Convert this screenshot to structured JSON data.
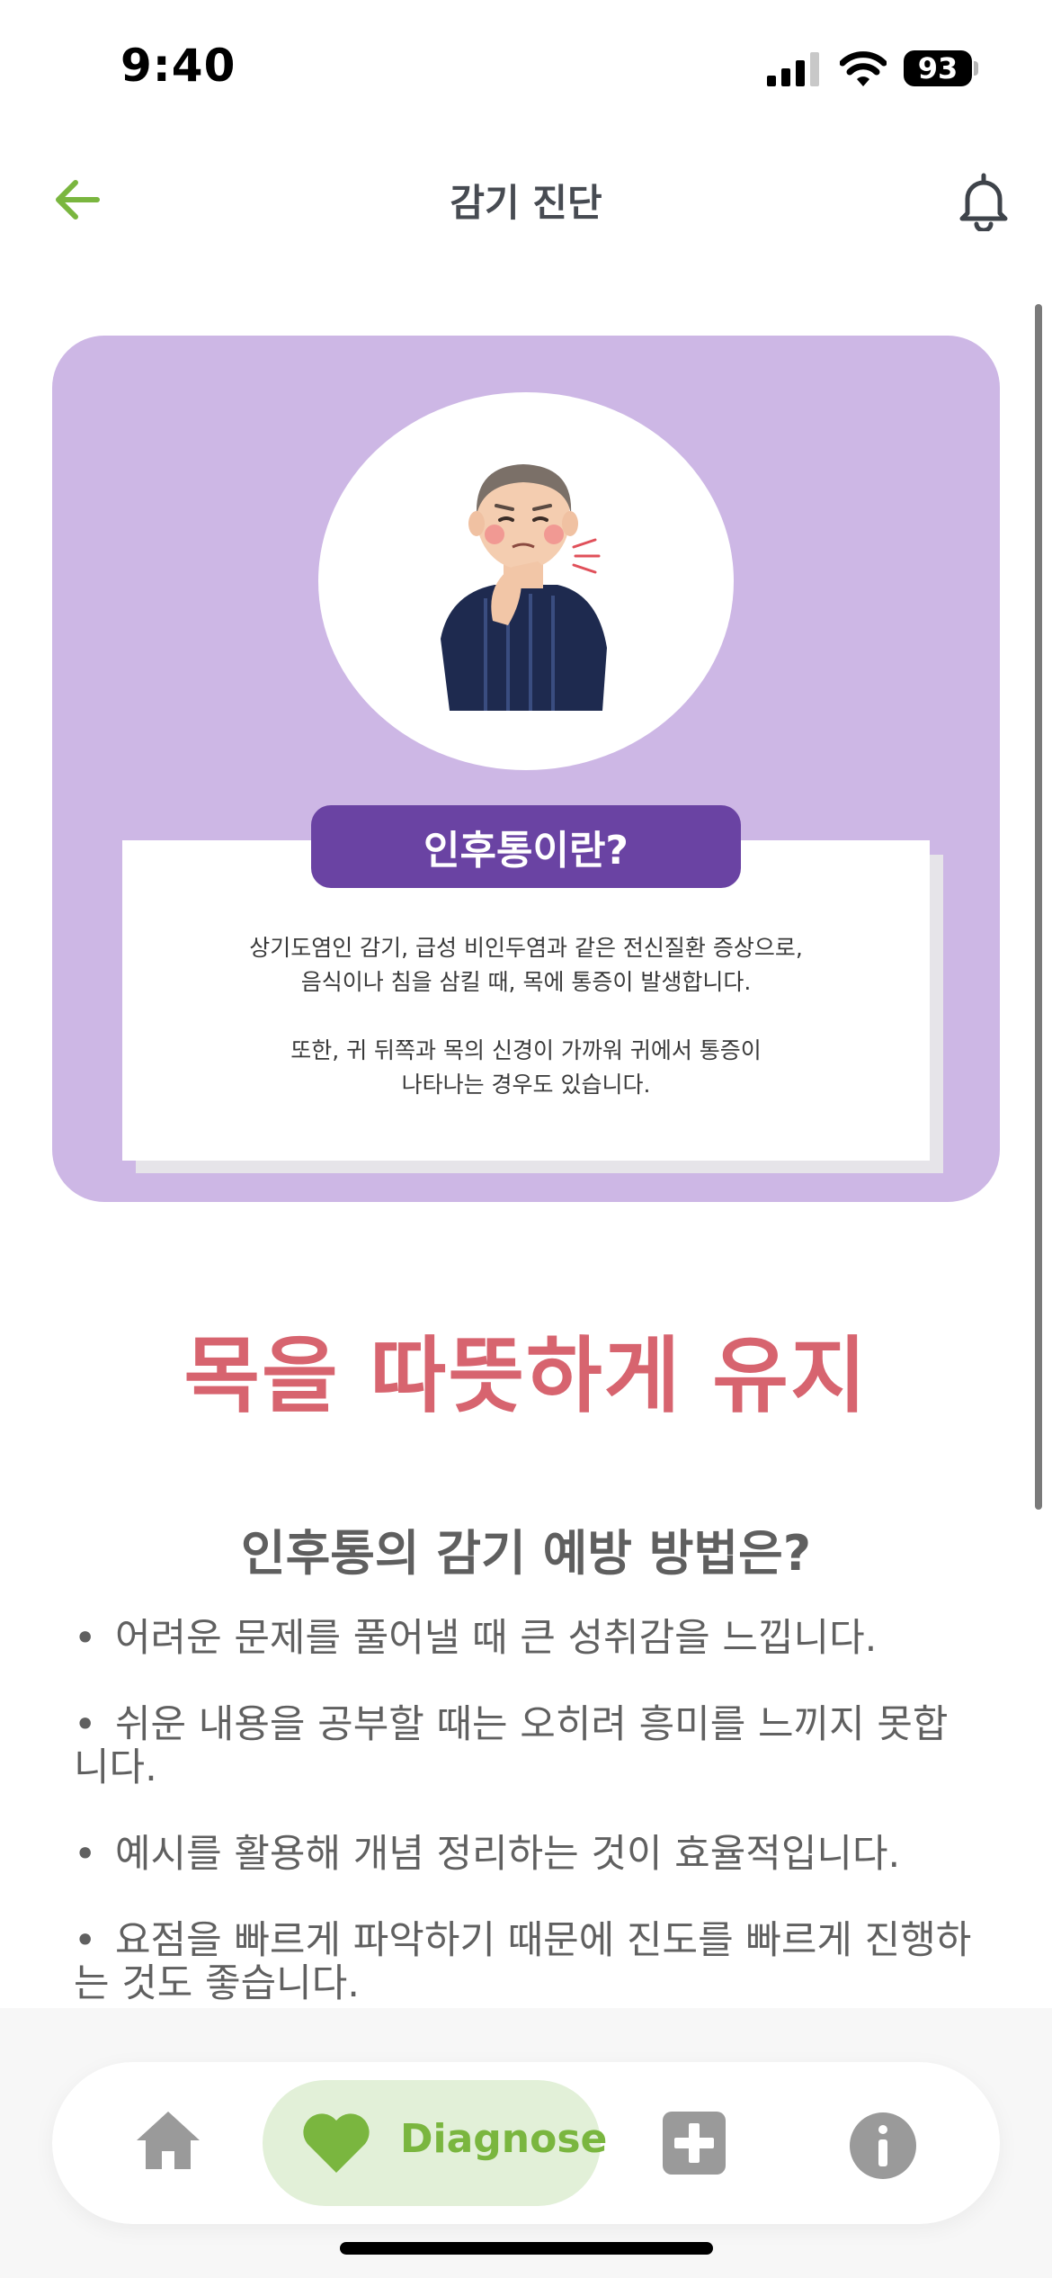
{
  "status_bar": {
    "time": "9:40",
    "battery": "93",
    "signal_icon": "cellular-signal-icon",
    "wifi_icon": "wifi-icon"
  },
  "header": {
    "title": "감기 진단",
    "back_icon": "back-arrow-icon",
    "bell_icon": "bell-icon"
  },
  "info_card": {
    "illustration": "man-with-sore-throat-illustration",
    "tab_title": "인후통이란?",
    "paragraph1_line1": "상기도염인 감기, 급성 비인두염과 같은 전신질환 증상으로,",
    "paragraph1_line2": "음식이나 침을 삼킬 때, 목에 통증이 발생합니다.",
    "paragraph2_line1": "또한, 귀 뒤쪽과 목의 신경이 가까워 귀에서 통증이",
    "paragraph2_line2": "나타나는 경우도 있습니다."
  },
  "headline": "목을 따뜻하게 유지",
  "prevention": {
    "heading": "인후통의 감기 예방 방법은?",
    "items": [
      "어려운 문제를 풀어낼 때 큰 성취감을 느낍니다.",
      "쉬운 내용을 공부할 때는 오히려 흥미를 느끼지 못합니다.",
      "예시를 활용해 개념 정리하는 것이 효율적입니다.",
      "요점을 빠르게 파악하기 때문에 진도를 빠르게 진행하는 것도 좋습니다."
    ]
  },
  "tab_bar": {
    "home_icon": "home-icon",
    "diagnose_label": "Diagnose",
    "diagnose_icon": "heart-icon",
    "medical_icon": "medical-plus-icon",
    "info_icon": "info-icon",
    "active_color": "#7ab63f",
    "active_bg": "#e2f0d8"
  },
  "colors": {
    "accent_green": "#7ab63f",
    "card_purple": "#cdb7e5",
    "tab_purple": "#6a43a3",
    "headline_red": "#d7646f"
  }
}
